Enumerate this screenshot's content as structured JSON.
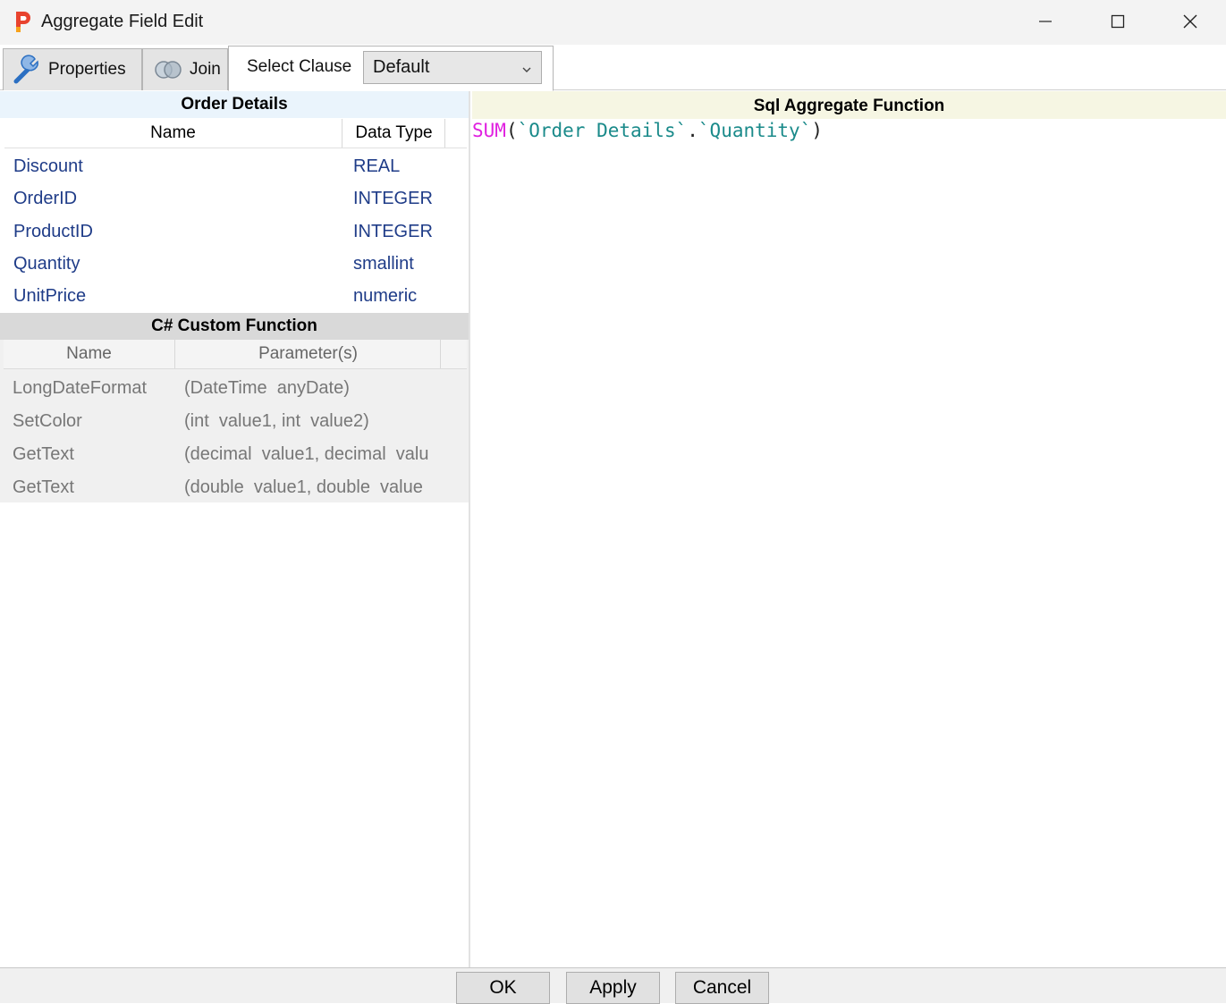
{
  "window": {
    "title": "Aggregate Field Edit"
  },
  "tabs": {
    "properties_label": "Properties",
    "join_label": "Join",
    "select_clause_label": "Select Clause",
    "select_clause_value": "Default"
  },
  "order_details": {
    "title": "Order Details",
    "col_name": "Name",
    "col_type": "Data Type",
    "rows": [
      {
        "name": "Discount",
        "type": "REAL"
      },
      {
        "name": "OrderID",
        "type": "INTEGER"
      },
      {
        "name": "ProductID",
        "type": "INTEGER"
      },
      {
        "name": "Quantity",
        "type": "smallint"
      },
      {
        "name": "UnitPrice",
        "type": "numeric"
      }
    ]
  },
  "custom_functions": {
    "title": "C# Custom Function",
    "col_name": "Name",
    "col_params": "Parameter(s)",
    "rows": [
      {
        "name": "LongDateFormat",
        "params": "(DateTime  anyDate)"
      },
      {
        "name": "SetColor",
        "params": "(int  value1, int  value2)"
      },
      {
        "name": "GetText",
        "params": "(decimal  value1, decimal  valu"
      },
      {
        "name": "GetText",
        "params": "(double  value1, double  value"
      }
    ]
  },
  "sql": {
    "title": "Sql Aggregate Function",
    "keyword": "SUM",
    "open_paren": "(",
    "table_ident": "`Order Details`",
    "dot": ".",
    "field_ident": "`Quantity`",
    "close_paren": ")"
  },
  "buttons": {
    "ok": "OK",
    "apply": "Apply",
    "cancel": "Cancel"
  },
  "colors": {
    "keyword": "#e020e0",
    "identifier": "#1a8a8a",
    "field_text": "#1f3c88"
  }
}
